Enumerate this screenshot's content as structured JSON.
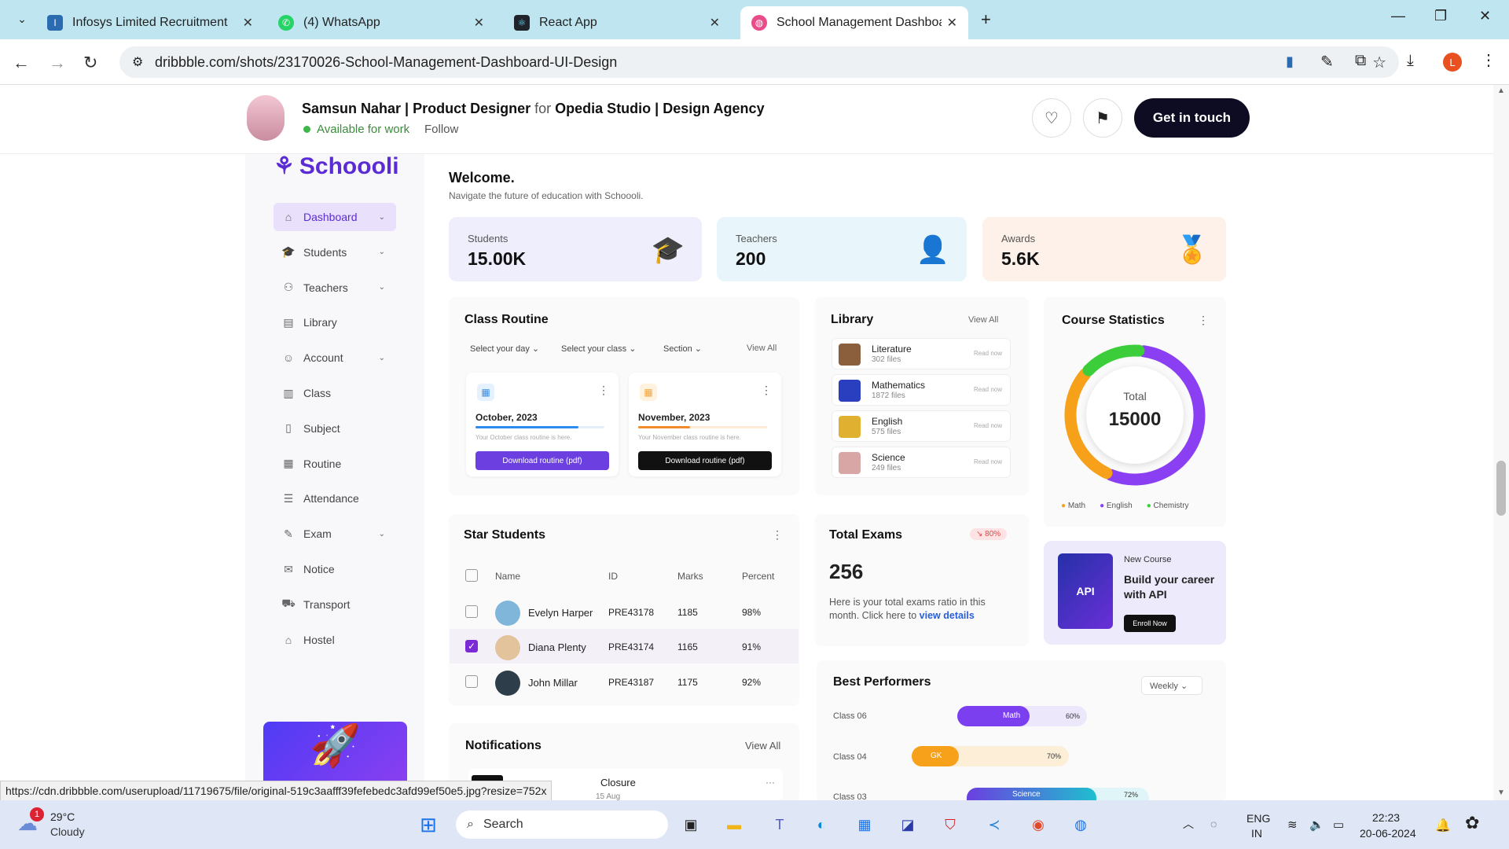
{
  "browser": {
    "tabs": [
      {
        "title": "Infosys Limited Recruitment",
        "icon": "infosys-icon"
      },
      {
        "title": "(4) WhatsApp",
        "icon": "whatsapp-icon"
      },
      {
        "title": "React App",
        "icon": "react-icon"
      },
      {
        "title": "School Management Dashboard",
        "icon": "dribbble-icon"
      }
    ],
    "url": "dribbble.com/shots/23170026-School-Management-Dashboard-UI-Design",
    "status_url": "https://cdn.dribbble.com/userupload/11719675/file/original-519c3aafff39fefebedc3afd99ef50e5.jpg?resize=752x",
    "profile_initial": "L"
  },
  "shot_header": {
    "designer": "Samsun Nahar | Product Designer",
    "for": "for",
    "agency": "Opedia Studio | Design Agency",
    "availability": "Available for work",
    "follow": "Follow",
    "cta": "Get in touch"
  },
  "sidebar": {
    "logo": "Schoooli",
    "items": [
      {
        "label": "Dashboard",
        "icon": "home-icon",
        "chevron": true
      },
      {
        "label": "Students",
        "icon": "graduation-cap-icon",
        "chevron": true
      },
      {
        "label": "Teachers",
        "icon": "people-icon",
        "chevron": true
      },
      {
        "label": "Library",
        "icon": "library-icon",
        "chevron": false
      },
      {
        "label": "Account",
        "icon": "account-icon",
        "chevron": true
      },
      {
        "label": "Class",
        "icon": "class-icon",
        "chevron": false
      },
      {
        "label": "Subject",
        "icon": "book-icon",
        "chevron": false
      },
      {
        "label": "Routine",
        "icon": "calendar-icon",
        "chevron": false
      },
      {
        "label": "Attendance",
        "icon": "attendance-icon",
        "chevron": false
      },
      {
        "label": "Exam",
        "icon": "exam-icon",
        "chevron": true
      },
      {
        "label": "Notice",
        "icon": "notice-icon",
        "chevron": false
      },
      {
        "label": "Transport",
        "icon": "bus-icon",
        "chevron": false
      },
      {
        "label": "Hostel",
        "icon": "hostel-icon",
        "chevron": false
      }
    ]
  },
  "welcome": {
    "title": "Welcome.",
    "subtitle": "Navigate the future of education with Schoooli."
  },
  "stats": [
    {
      "label": "Students",
      "value": "15.00K",
      "bg": "#efeefc",
      "icon": "graduation-cap-icon"
    },
    {
      "label": "Teachers",
      "value": "200",
      "bg": "#e8f6fb",
      "icon": "teacher-icon"
    },
    {
      "label": "Awards",
      "value": "5.6K",
      "bg": "#fdf1ea",
      "icon": "medal-icon"
    }
  ],
  "class_routine": {
    "title": "Class Routine",
    "filters": [
      "Select your day",
      "Select your class",
      "Section"
    ],
    "view_all": "View All",
    "cards": [
      {
        "month": "October, 2023",
        "note": "Your October class routine is here.",
        "button": "Download routine (pdf)",
        "progress": 0.8
      },
      {
        "month": "November, 2023",
        "note": "Your November class routine is here.",
        "button": "Download routine (pdf)",
        "progress": 0.4
      }
    ]
  },
  "library": {
    "title": "Library",
    "view_all": "View All",
    "items": [
      {
        "name": "Literature",
        "files": "302 files",
        "action": "Read now"
      },
      {
        "name": "Mathematics",
        "files": "1872 files",
        "action": "Read now"
      },
      {
        "name": "English",
        "files": "575 files",
        "action": "Read now"
      },
      {
        "name": "Science",
        "files": "249 files",
        "action": "Read now"
      }
    ]
  },
  "course_stats": {
    "title": "Course Statistics",
    "center_label": "Total",
    "center_value": "15000",
    "legend": [
      "Math",
      "English",
      "Chemistry"
    ]
  },
  "chart_data": {
    "type": "pie",
    "title": "Course Statistics",
    "categories": [
      "English",
      "Math",
      "Chemistry"
    ],
    "values": [
      55,
      30,
      15
    ],
    "colors": [
      "#8b3ff2",
      "#f7a11a",
      "#3ccd3a"
    ]
  },
  "star_students": {
    "title": "Star Students",
    "columns": [
      "Name",
      "ID",
      "Marks",
      "Percent"
    ],
    "rows": [
      {
        "name": "Evelyn Harper",
        "id": "PRE43178",
        "marks": "1185",
        "percent": "98%",
        "checked": false
      },
      {
        "name": "Diana Plenty",
        "id": "PRE43174",
        "marks": "1165",
        "percent": "91%",
        "checked": true
      },
      {
        "name": "John Millar",
        "id": "PRE43187",
        "marks": "1175",
        "percent": "92%",
        "checked": false
      }
    ]
  },
  "total_exams": {
    "title": "Total Exams",
    "badge": "80%",
    "value": "256",
    "text": "Here is your total exams ratio in this month. Click here to",
    "link": "view details"
  },
  "new_course": {
    "tag": "New Course",
    "title": "Build your career with API",
    "button": "Enroll Now",
    "image_text": "API"
  },
  "notifications": {
    "title": "Notifications",
    "view_all": "View All",
    "item_title": "Closure",
    "item_date": "15 Aug"
  },
  "best_performers": {
    "title": "Best Performers",
    "period": "Weekly",
    "rows": [
      {
        "class": "Class 06",
        "subject": "Math",
        "percent": "60%",
        "color": "#7b3ff0"
      },
      {
        "class": "Class 04",
        "subject": "GK",
        "percent": "70%",
        "color": "#f7a11a"
      },
      {
        "class": "Class 03",
        "subject": "Science",
        "percent": "72%",
        "color": "#1fbfcf"
      }
    ]
  },
  "taskbar": {
    "weather_temp": "29°C",
    "weather_desc": "Cloudy",
    "weather_badge": "1",
    "search": "Search",
    "lang1": "ENG",
    "lang2": "IN",
    "time": "22:23",
    "date": "20-06-2024"
  }
}
